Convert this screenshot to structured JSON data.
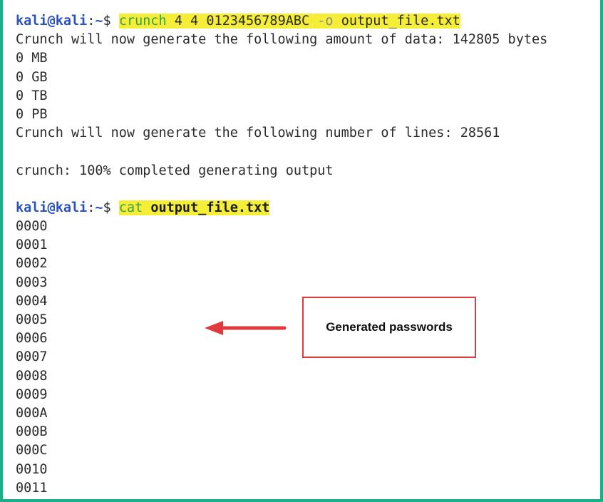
{
  "terminal": {
    "commands": [
      {
        "prompt_user": "kali@kali",
        "prompt_colon": ":",
        "prompt_path": "~",
        "prompt_symbol": "$",
        "command": "crunch",
        "args": "4 4 0123456789ABC",
        "flag": "-o",
        "file": "output_file.txt"
      },
      {
        "prompt_user": "kali@kali",
        "prompt_colon": ":",
        "prompt_path": "~",
        "prompt_symbol": "$",
        "command": "cat",
        "file": "output_file.txt"
      }
    ],
    "crunch_output": [
      "Crunch will now generate the following amount of data: 142805 bytes",
      "0 MB",
      "0 GB",
      "0 TB",
      "0 PB",
      "Crunch will now generate the following number of lines: 28561",
      "",
      "crunch: 100% completed generating output",
      ""
    ],
    "cat_output": [
      "0000",
      "0001",
      "0002",
      "0003",
      "0004",
      "0005",
      "0006",
      "0007",
      "0008",
      "0009",
      "000A",
      "000B",
      "000C",
      "0010",
      "0011"
    ]
  },
  "annotation": {
    "label": "Generated passwords",
    "color": "#e0393e"
  },
  "colors": {
    "frame": "#1bb08a",
    "highlight": "#f5ee38",
    "prompt": "#2a52be",
    "command": "#3aa04a"
  }
}
